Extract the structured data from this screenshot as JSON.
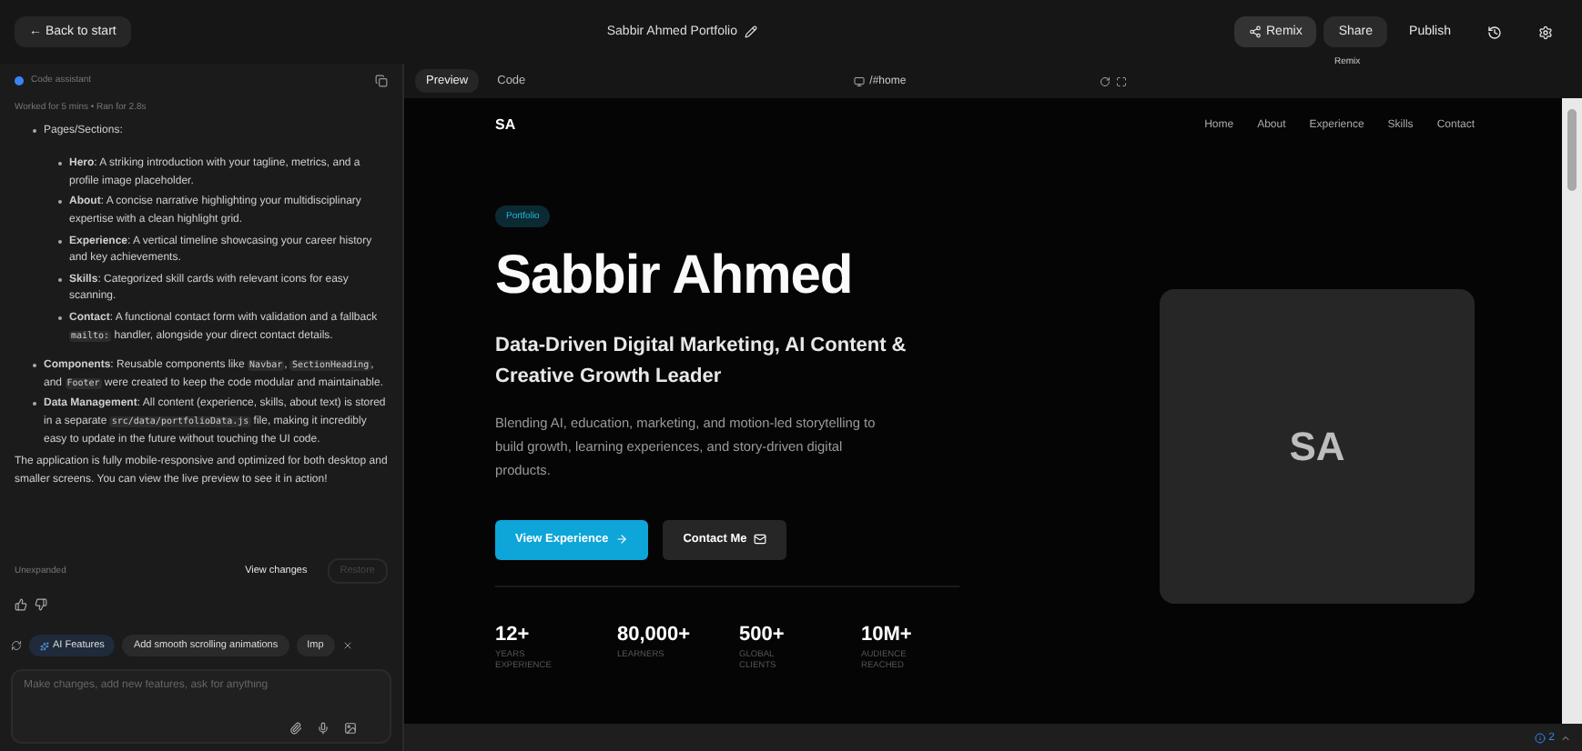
{
  "top_bar": {
    "back": "← Back to start",
    "title": "Sabbir Ahmed Portfolio",
    "remix": "Remix",
    "share": "Share",
    "publish": "Publish",
    "tooltip": "Remix"
  },
  "assistant": {
    "title": "Code assistant",
    "meta": "Worked for 5 mins • Ran for 2.8s",
    "items": [
      {
        "segments": [
          {
            "kind": "text",
            "text": "Pages/Sections:"
          }
        ],
        "children": [
          {
            "segments": [
              {
                "kind": "bold",
                "text": "Hero"
              },
              {
                "kind": "text",
                "text": ": A striking introduction with your tagline, metrics, and a profile image placeholder."
              }
            ]
          },
          {
            "segments": [
              {
                "kind": "bold",
                "text": "About"
              },
              {
                "kind": "text",
                "text": ": A concise narrative highlighting your multidisciplinary expertise with a clean highlight grid."
              }
            ]
          },
          {
            "segments": [
              {
                "kind": "bold",
                "text": "Experience"
              },
              {
                "kind": "text",
                "text": ": A vertical timeline showcasing your career history and key achievements."
              }
            ]
          },
          {
            "segments": [
              {
                "kind": "bold",
                "text": "Skills"
              },
              {
                "kind": "text",
                "text": ": Categorized skill cards with relevant icons for easy scanning."
              }
            ]
          },
          {
            "segments": [
              {
                "kind": "bold",
                "text": "Contact"
              },
              {
                "kind": "text",
                "text": ": A functional contact form with validation and a fallback "
              },
              {
                "kind": "code",
                "text": "mailto:"
              },
              {
                "kind": "text",
                "text": " handler, alongside your direct contact details."
              }
            ]
          }
        ]
      },
      {
        "segments": [
          {
            "kind": "bold",
            "text": "Components"
          },
          {
            "kind": "text",
            "text": ": Reusable components like "
          },
          {
            "kind": "code",
            "text": "Navbar"
          },
          {
            "kind": "text",
            "text": ", "
          },
          {
            "kind": "code",
            "text": "SectionHeading"
          },
          {
            "kind": "text",
            "text": ", and "
          },
          {
            "kind": "code",
            "text": "Footer"
          },
          {
            "kind": "text",
            "text": " were created to keep the code modular and maintainable."
          }
        ]
      },
      {
        "segments": [
          {
            "kind": "bold",
            "text": "Data Management"
          },
          {
            "kind": "text",
            "text": ": All content (experience, skills, about text) is stored in a separate "
          },
          {
            "kind": "code",
            "text": "src/data/portfolioData.js"
          },
          {
            "kind": "text",
            "text": " file, making it incredibly easy to update in the future without touching the UI code."
          }
        ]
      }
    ],
    "summary": "The application is fully mobile-responsive and optimized for both desktop and smaller screens. You can view the live preview to see it in action!",
    "changes": "Unexpanded",
    "view_changes": "View changes",
    "restore": "Restore",
    "chips": [
      {
        "kind": "feature",
        "label": "AI Features"
      },
      {
        "kind": "plain",
        "label": "Add smooth scrolling animations"
      },
      {
        "kind": "plain",
        "label": "Imp"
      }
    ],
    "input": {
      "placeholder": "Make changes, add new features, ask for anything"
    }
  },
  "view_tabs": [
    {
      "label": "Preview",
      "selected": true
    },
    {
      "label": "Code",
      "selected": false
    }
  ],
  "url": "/#home",
  "site": {
    "logo": "SA",
    "nav": [
      "Home",
      "About",
      "Experience",
      "Skills",
      "Contact"
    ],
    "badge": "Portfolio",
    "name": "Sabbir Ahmed",
    "tagline": "Data-Driven Digital Marketing, AI Content & Creative Growth Leader",
    "intro": "Blending AI, education, marketing, and motion-led storytelling to build growth, learning experiences, and story-driven digital products.",
    "primary": "View Experience",
    "secondary": "Contact Me",
    "stats": [
      {
        "value": "12+",
        "label": "YEARS EXPERIENCE"
      },
      {
        "value": "80,000+",
        "label": "LEARNERS"
      },
      {
        "value": "500+",
        "label": "GLOBAL CLIENTS"
      },
      {
        "value": "10M+",
        "label": "AUDIENCE REACHED"
      }
    ],
    "avatar": "SA"
  },
  "status_bar": {
    "issues": "2"
  }
}
